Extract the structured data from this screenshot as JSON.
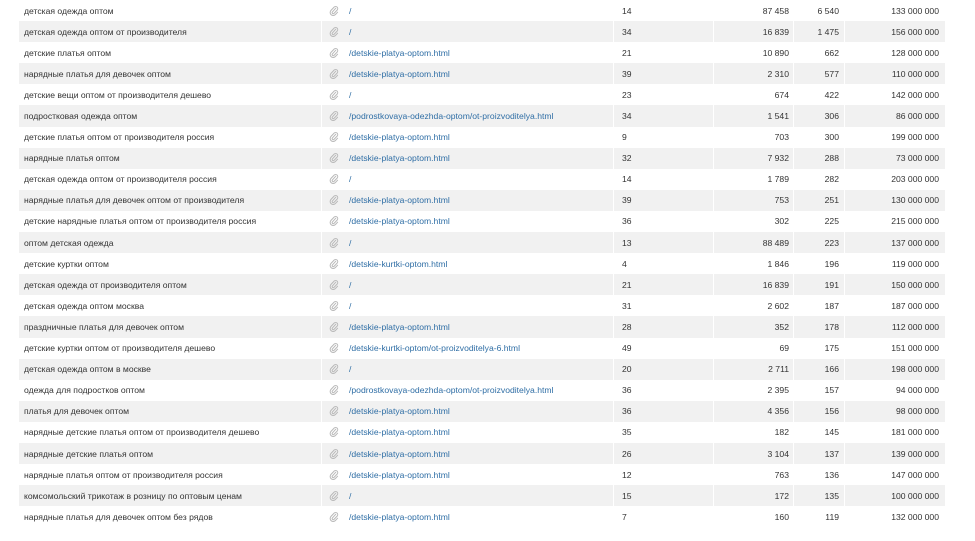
{
  "colors": {
    "link": "#2f6ea5",
    "stripe": "#f1f1f1",
    "text": "#333333",
    "icon": "#b8b8b8"
  },
  "rows": [
    {
      "keyword": "детская одежда оптом",
      "url": "/",
      "position": "14",
      "freq": "87 458",
      "exact": "6 540",
      "budget": "133 000 000"
    },
    {
      "keyword": "детская одежда оптом от производителя",
      "url": "/",
      "position": "34",
      "freq": "16 839",
      "exact": "1 475",
      "budget": "156 000 000"
    },
    {
      "keyword": "детские платья оптом",
      "url": "/detskie-platya-optom.html",
      "position": "21",
      "freq": "10 890",
      "exact": "662",
      "budget": "128 000 000"
    },
    {
      "keyword": "нарядные платья для девочек оптом",
      "url": "/detskie-platya-optom.html",
      "position": "39",
      "freq": "2 310",
      "exact": "577",
      "budget": "110 000 000"
    },
    {
      "keyword": "детские вещи оптом от производителя дешево",
      "url": "/",
      "position": "23",
      "freq": "674",
      "exact": "422",
      "budget": "142 000 000"
    },
    {
      "keyword": "подростковая одежда оптом",
      "url": "/podrostkovaya-odezhda-optom/ot-proizvoditelya.html",
      "position": "34",
      "freq": "1 541",
      "exact": "306",
      "budget": "86 000 000"
    },
    {
      "keyword": "детские платья оптом от производителя россия",
      "url": "/detskie-platya-optom.html",
      "position": "9",
      "freq": "703",
      "exact": "300",
      "budget": "199 000 000"
    },
    {
      "keyword": "нарядные платья оптом",
      "url": "/detskie-platya-optom.html",
      "position": "32",
      "freq": "7 932",
      "exact": "288",
      "budget": "73 000 000"
    },
    {
      "keyword": "детская одежда оптом от производителя россия",
      "url": "/",
      "position": "14",
      "freq": "1 789",
      "exact": "282",
      "budget": "203 000 000"
    },
    {
      "keyword": "нарядные платья для девочек оптом от производителя",
      "url": "/detskie-platya-optom.html",
      "position": "39",
      "freq": "753",
      "exact": "251",
      "budget": "130 000 000"
    },
    {
      "keyword": "детские нарядные платья оптом от производителя россия",
      "url": "/detskie-platya-optom.html",
      "position": "36",
      "freq": "302",
      "exact": "225",
      "budget": "215 000 000"
    },
    {
      "keyword": "оптом детская одежда",
      "url": "/",
      "position": "13",
      "freq": "88 489",
      "exact": "223",
      "budget": "137 000 000"
    },
    {
      "keyword": "детские куртки оптом",
      "url": "/detskie-kurtki-optom.html",
      "position": "4",
      "freq": "1 846",
      "exact": "196",
      "budget": "119 000 000"
    },
    {
      "keyword": "детская одежда от производителя оптом",
      "url": "/",
      "position": "21",
      "freq": "16 839",
      "exact": "191",
      "budget": "150 000 000"
    },
    {
      "keyword": "детская одежда оптом москва",
      "url": "/",
      "position": "31",
      "freq": "2 602",
      "exact": "187",
      "budget": "187 000 000"
    },
    {
      "keyword": "праздничные платья для девочек оптом",
      "url": "/detskie-platya-optom.html",
      "position": "28",
      "freq": "352",
      "exact": "178",
      "budget": "112 000 000"
    },
    {
      "keyword": "детские куртки оптом от производителя дешево",
      "url": "/detskie-kurtki-optom/ot-proizvoditelya-6.html",
      "position": "49",
      "freq": "69",
      "exact": "175",
      "budget": "151 000 000"
    },
    {
      "keyword": "детская одежда оптом в москве",
      "url": "/",
      "position": "20",
      "freq": "2 711",
      "exact": "166",
      "budget": "198 000 000"
    },
    {
      "keyword": "одежда для подростков оптом",
      "url": "/podrostkovaya-odezhda-optom/ot-proizvoditelya.html",
      "position": "36",
      "freq": "2 395",
      "exact": "157",
      "budget": "94 000 000"
    },
    {
      "keyword": "платья для девочек оптом",
      "url": "/detskie-platya-optom.html",
      "position": "36",
      "freq": "4 356",
      "exact": "156",
      "budget": "98 000 000"
    },
    {
      "keyword": "нарядные детские платья оптом от производителя дешево",
      "url": "/detskie-platya-optom.html",
      "position": "35",
      "freq": "182",
      "exact": "145",
      "budget": "181 000 000"
    },
    {
      "keyword": "нарядные детские платья оптом",
      "url": "/detskie-platya-optom.html",
      "position": "26",
      "freq": "3 104",
      "exact": "137",
      "budget": "139 000 000"
    },
    {
      "keyword": "нарядные платья оптом от производителя россия",
      "url": "/detskie-platya-optom.html",
      "position": "12",
      "freq": "763",
      "exact": "136",
      "budget": "147 000 000"
    },
    {
      "keyword": "комсомольский трикотаж в розницу по оптовым ценам",
      "url": "/",
      "position": "15",
      "freq": "172",
      "exact": "135",
      "budget": "100 000 000"
    },
    {
      "keyword": "нарядные платья для девочек оптом без рядов",
      "url": "/detskie-platya-optom.html",
      "position": "7",
      "freq": "160",
      "exact": "119",
      "budget": "132 000 000"
    }
  ]
}
